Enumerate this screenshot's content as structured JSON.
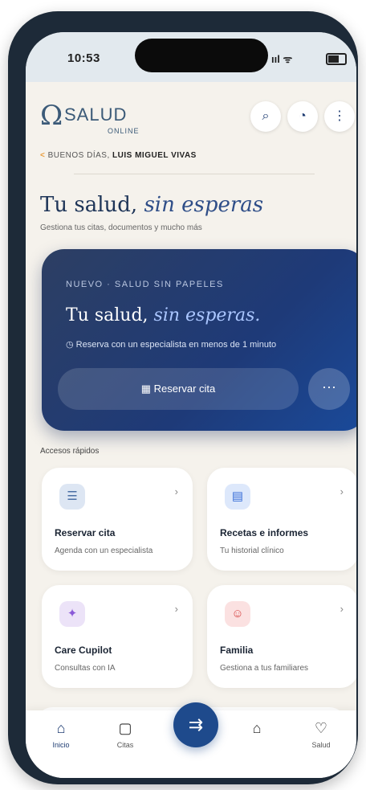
{
  "status_bar": {
    "time": "10:53",
    "signal": "ııl ᯤ"
  },
  "logo": {
    "brand": "SALUD",
    "subtitle": "ONLINE"
  },
  "header": {
    "icons": [
      "search-icon",
      "notification-icon",
      "more-vertical-icon"
    ]
  },
  "breadcrumb": {
    "arrow": "<",
    "prefix": "BUENOS DÍAS,",
    "name": "LUIS MIGUEL VIVAS"
  },
  "page": {
    "title_plain": "Tu salud,",
    "title_italic": "sin esperas",
    "subtitle": "Gestiona tus citas, documentos y mucho más"
  },
  "hero": {
    "kicker": "NUEVO · SALUD SIN PAPELES",
    "title_plain": "Tu salud,",
    "title_italic": "sin esperas.",
    "description": "Reserva con un especialista en menos de 1 minuto",
    "cta_label": "Reservar cita",
    "more_label": "···"
  },
  "section_title": "Accesos rápidos",
  "cards": [
    {
      "title": "Reservar cita",
      "subtitle": "Agenda con un especialista",
      "icon": "calendar-list-icon",
      "color": "#dde6f3",
      "icon_color": "#4a6fa5"
    },
    {
      "title": "Recetas e informes",
      "subtitle": "Tu historial clínico",
      "icon": "document-icon",
      "color": "#dde8fb",
      "icon_color": "#3a6fd8"
    },
    {
      "title": "Care Cupilot",
      "subtitle": "Consultas con IA",
      "icon": "sparkle-icon",
      "color": "#ece3f8",
      "icon_color": "#8a5ad8"
    },
    {
      "title": "Familia",
      "subtitle": "Gestiona a tus familiares",
      "icon": "people-icon",
      "color": "#fbe1e1",
      "icon_color": "#d84a4a"
    }
  ],
  "tabbar": {
    "tabs": [
      {
        "label": "Inicio",
        "icon": "home-icon"
      },
      {
        "label": "Citas",
        "icon": "calendar-icon"
      },
      {
        "label": "",
        "icon": "hospital-icon"
      },
      {
        "label": "Salud",
        "icon": "heart-icon"
      }
    ],
    "fab_icon": "calendar-check-icon"
  }
}
